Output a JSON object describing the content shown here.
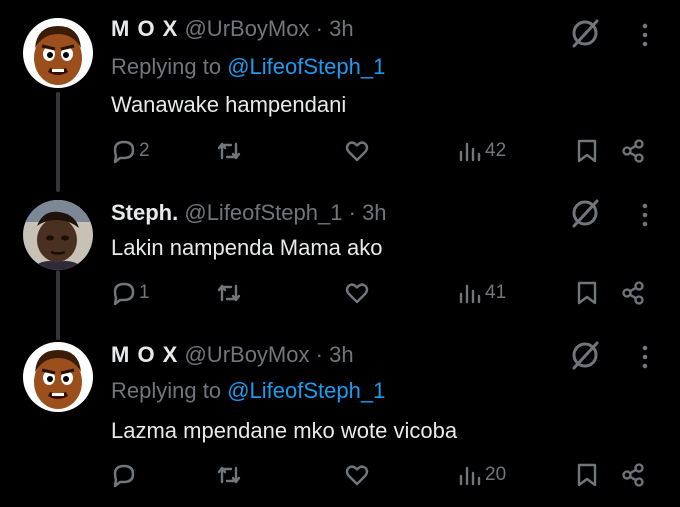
{
  "tweets": [
    {
      "name": "M O X",
      "handle": "@UrBoyMox",
      "separator": "·",
      "time": "3h",
      "replying_prefix": "Replying to ",
      "replying_to": "@LifeofSteph_1",
      "text": "Wanawake hampendani",
      "replies": "2",
      "retweets": "",
      "likes": "",
      "views": "42",
      "avatar": "cartoon-boy-avatar"
    },
    {
      "name": "Steph.",
      "handle": "@LifeofSteph_1",
      "separator": "·",
      "time": "3h",
      "text": "Lakin nampenda Mama ako",
      "replies": "1",
      "retweets": "",
      "likes": "",
      "views": "41",
      "avatar": "photo-avatar"
    },
    {
      "name": "M O X",
      "handle": "@UrBoyMox",
      "separator": "·",
      "time": "3h",
      "replying_prefix": "Replying to ",
      "replying_to": "@LifeofSteph_1",
      "text": "Lazma mpendane mko wote vicoba",
      "replies": "",
      "retweets": "",
      "likes": "",
      "views": "20",
      "avatar": "cartoon-boy-avatar"
    }
  ],
  "colors": {
    "background": "#000000",
    "text": "#e7e9ea",
    "muted": "#71767b",
    "link": "#1d9bf0",
    "thread_line": "#333639"
  },
  "icons": [
    "reply-icon",
    "retweet-icon",
    "like-icon",
    "views-icon",
    "bookmark-icon",
    "share-icon",
    "grok-icon",
    "more-icon"
  ]
}
